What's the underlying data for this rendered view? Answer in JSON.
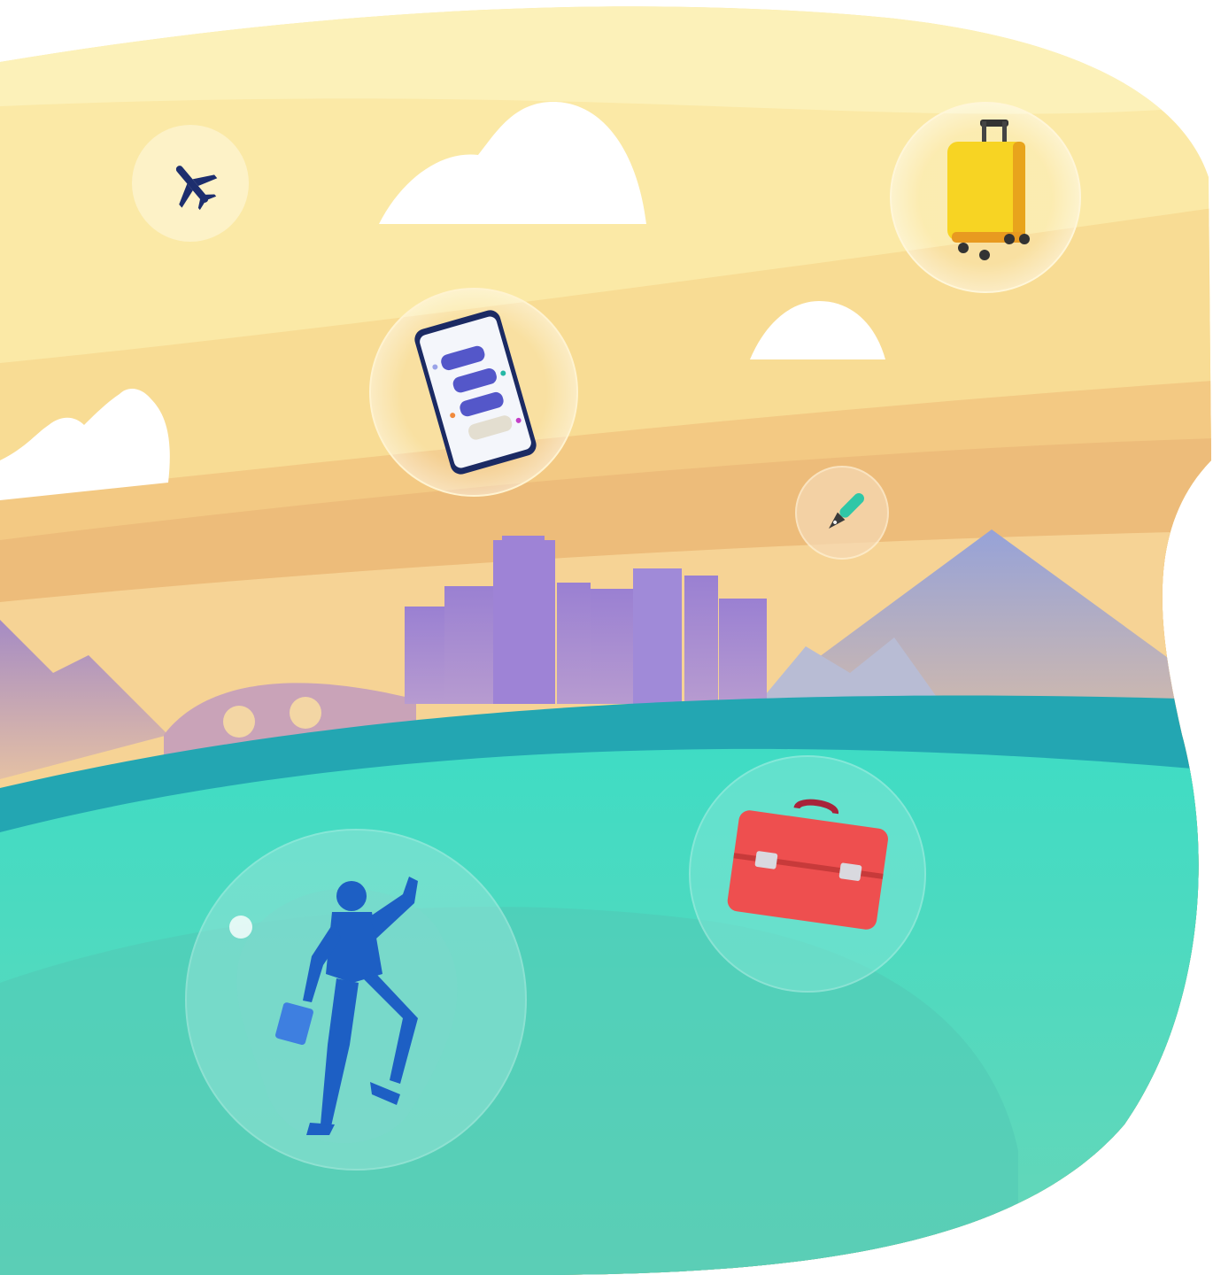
{
  "scene": {
    "description_free": true,
    "colors": {
      "sky_top": "#fbeaa8",
      "sky_band_1": "#fbe9a6",
      "sky_band_2": "#f8d98c",
      "sky_band_3": "#f3c887",
      "sky_band_4": "#eab878",
      "horizon": "#f6d38f",
      "mountain": "#9aa6d6",
      "buildings": "#9d86d2",
      "sea_dark": "#21a6b1",
      "sea_mid": "#3fd9c2",
      "sea_light": "#6dd6bb",
      "cloud": "#ffffff",
      "suitcase": "#f7d423",
      "briefcase": "#ee4f4f",
      "person": "#1d5fc4",
      "plane": "#1d2e6e"
    },
    "icons": [
      "airplane-icon",
      "cloud-icon",
      "suitcase-icon",
      "smartphone-chat-icon",
      "pen-brush-icon",
      "city-skyline-icon",
      "mountain-icon",
      "bridge-icon",
      "briefcase-icon",
      "businessman-icon"
    ]
  }
}
